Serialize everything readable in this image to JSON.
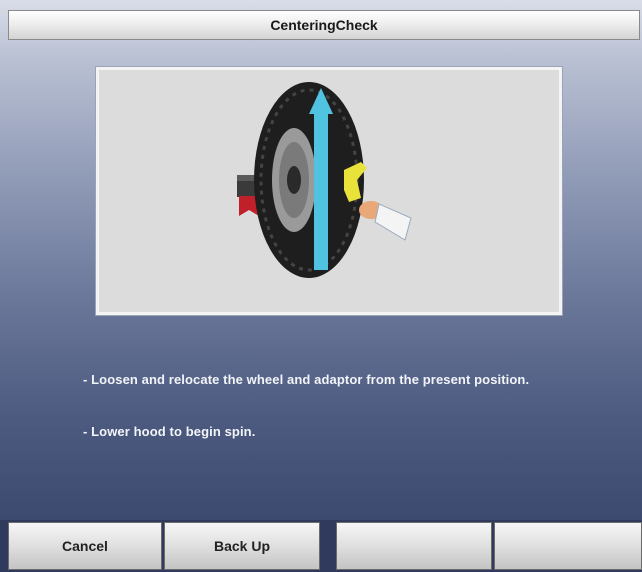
{
  "window": {
    "title": "CenteringCheck"
  },
  "illustration": {
    "icon": "wheel-balancer-centering-icon",
    "arrow_color": "#4fc3e0",
    "adaptor_color": "#e8e23a",
    "flange_color": "#c0202a"
  },
  "instructions": [
    "- Loosen and relocate the wheel and adaptor from the present position.",
    "- Lower hood to begin spin."
  ],
  "buttons": [
    {
      "label": "Cancel"
    },
    {
      "label": "Back Up"
    },
    {
      "label": ""
    },
    {
      "label": ""
    }
  ]
}
